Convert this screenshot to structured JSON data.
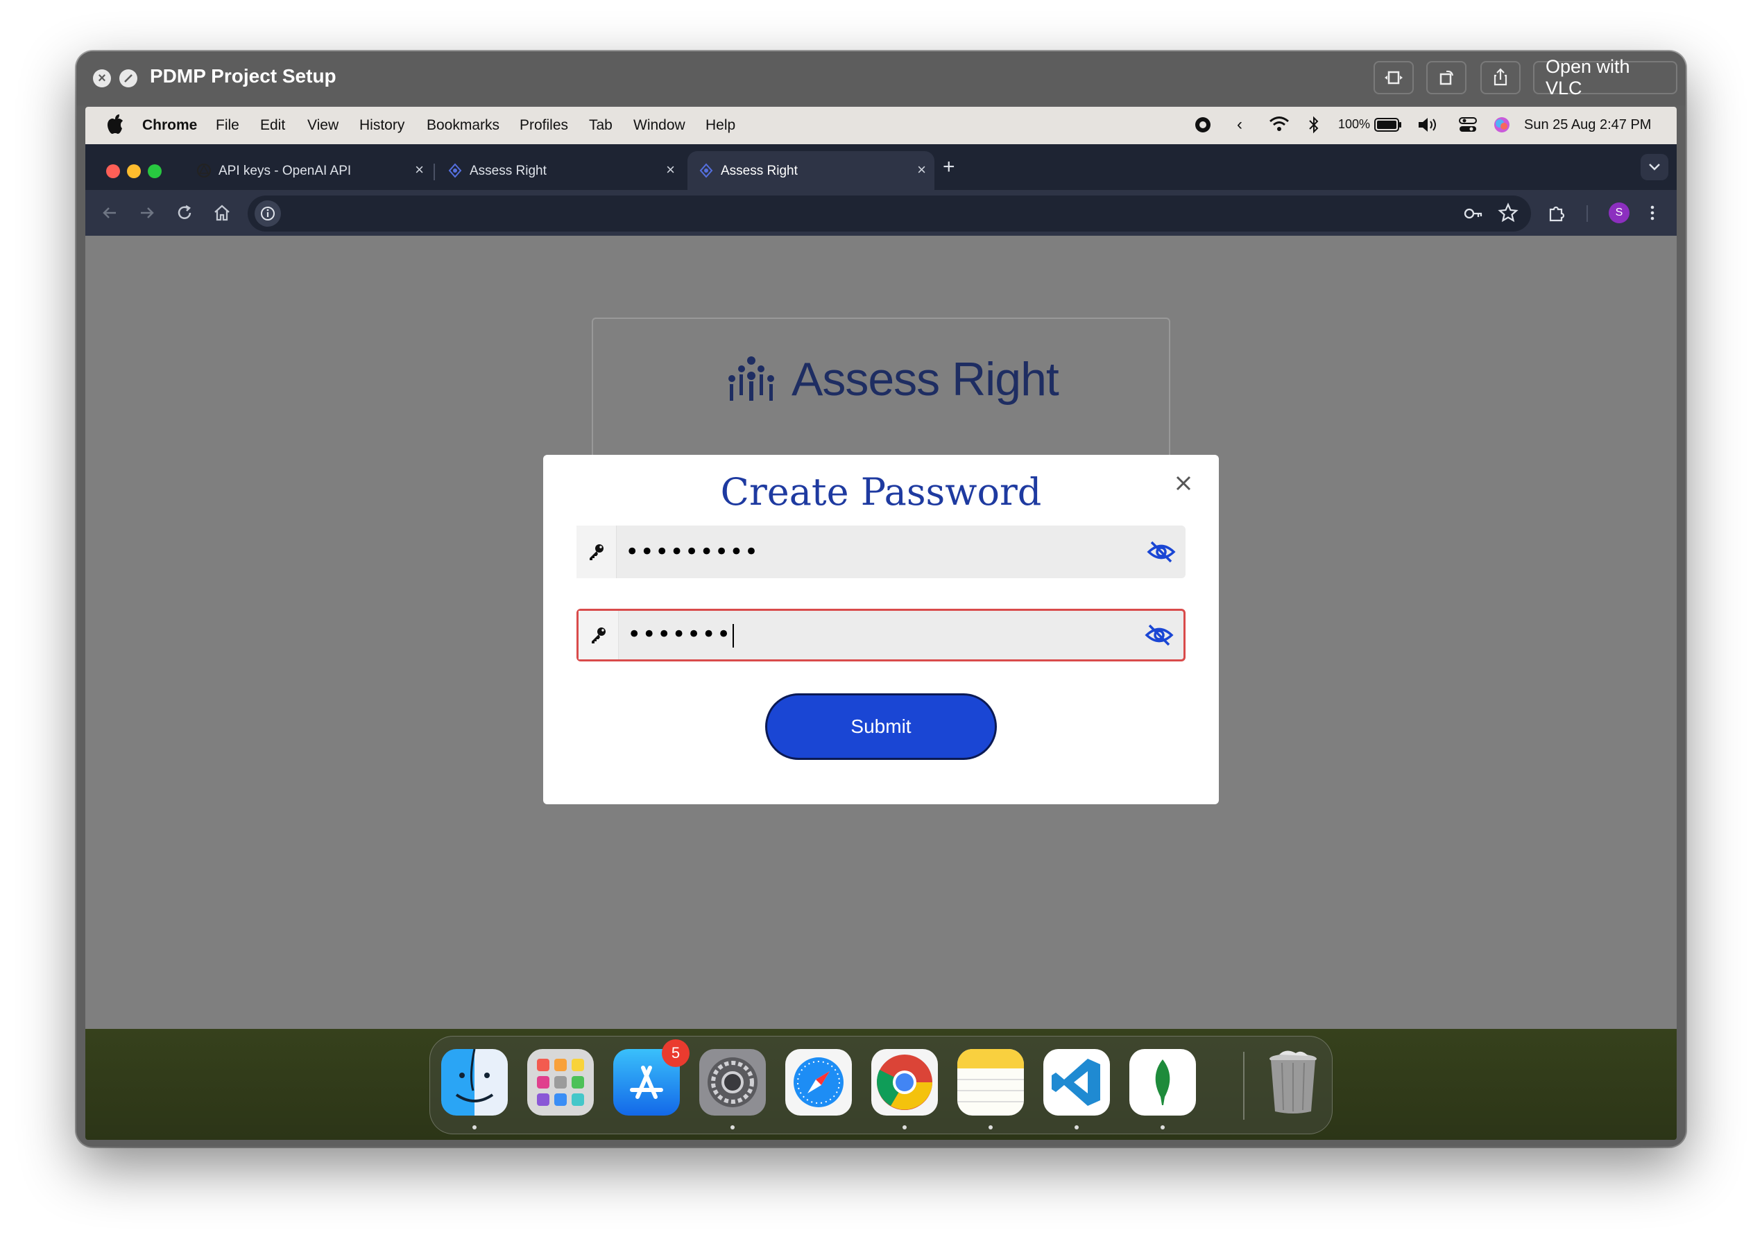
{
  "quicklook": {
    "title": "PDMP Project Setup",
    "open_with_label": "Open with VLC"
  },
  "menubar": {
    "items": [
      "Chrome",
      "File",
      "Edit",
      "View",
      "History",
      "Bookmarks",
      "Profiles",
      "Tab",
      "Window",
      "Help"
    ],
    "battery": "100%",
    "datetime": "Sun 25 Aug  2:47 PM"
  },
  "browser": {
    "tabs": [
      {
        "label": "API keys - OpenAI API",
        "active": false
      },
      {
        "label": "Assess Right",
        "active": false
      },
      {
        "label": "Assess Right",
        "active": true
      }
    ],
    "profile_initial": "S"
  },
  "page": {
    "brand": "Assess Right"
  },
  "modal": {
    "title": "Create Password",
    "password_value": "•••••••••",
    "confirm_value": "•••••••",
    "submit_label": "Submit"
  },
  "dock": {
    "apps": [
      "Finder",
      "Launchpad",
      "App Store",
      "System Settings",
      "Safari",
      "Google Chrome",
      "Notes",
      "Visual Studio Code",
      "MongoDB Compass",
      "Trash"
    ],
    "app_store_badge": "5"
  },
  "colors": {
    "accent": "#1a46d4",
    "modal_title": "#1e3aa0",
    "error_border": "#d94b4b",
    "chrome_dark": "#1e2433"
  }
}
